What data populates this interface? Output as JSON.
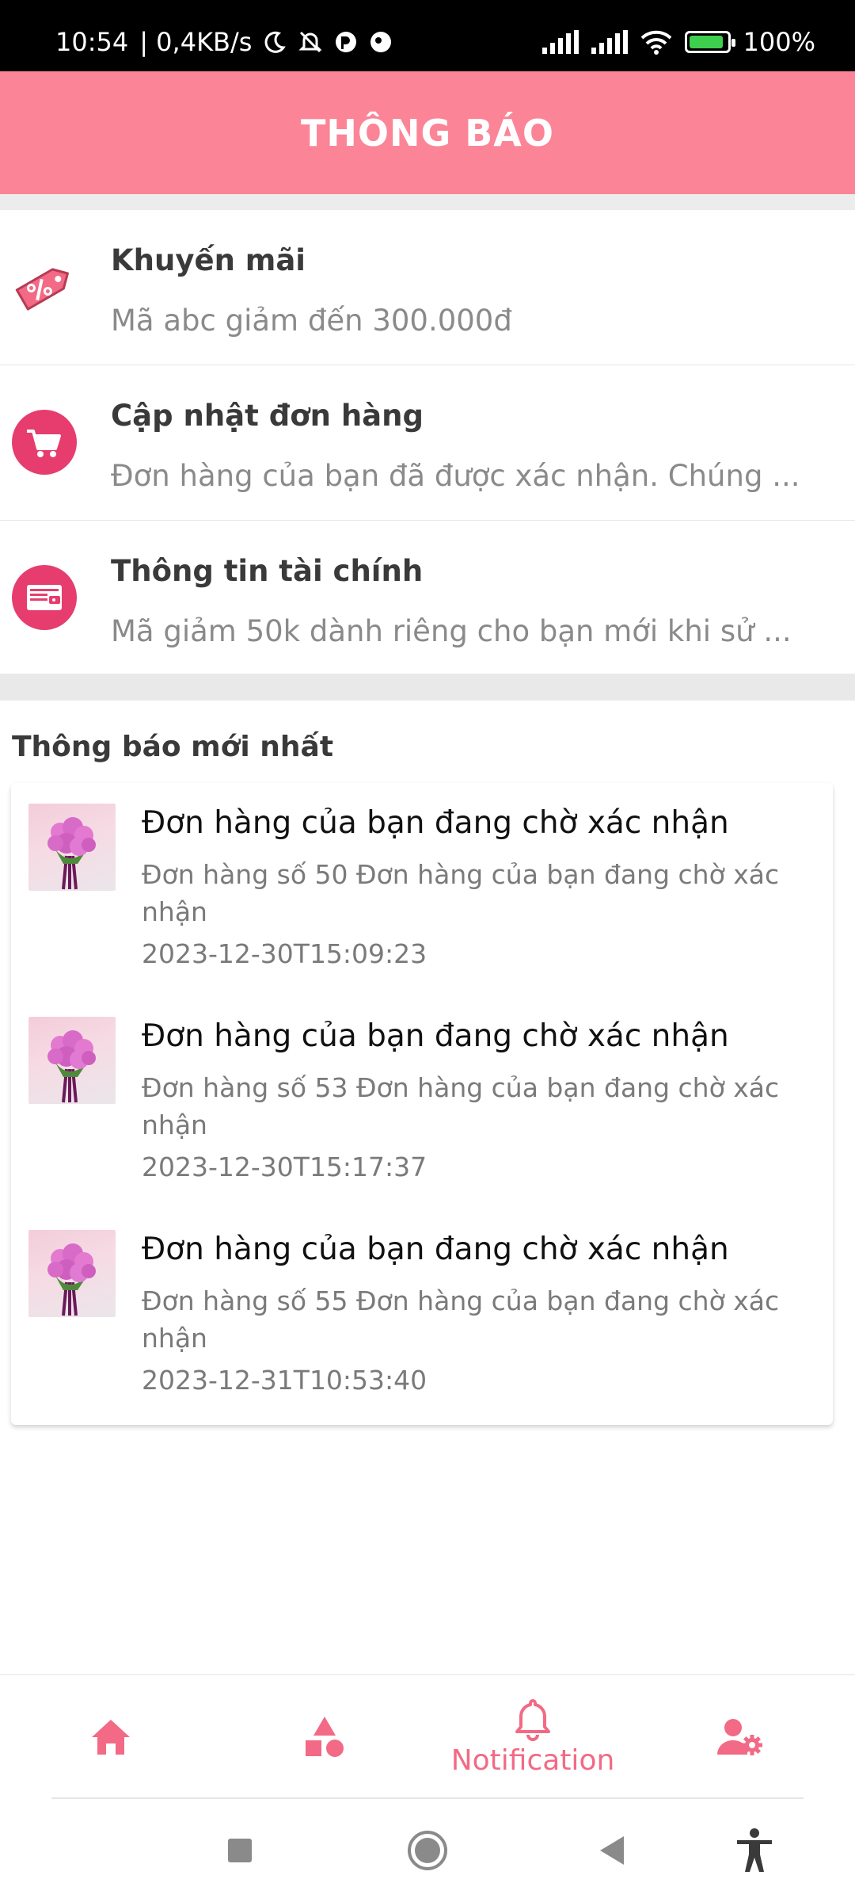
{
  "status_bar": {
    "time": "10:54",
    "speed": "| 0,4KB/s",
    "battery": "100%"
  },
  "header": {
    "title": "THÔNG BÁO"
  },
  "categories": [
    {
      "icon": "discount-tag-icon",
      "title": "Khuyến mãi",
      "desc": "Mã abc giảm đến 300.000đ"
    },
    {
      "icon": "cart-icon",
      "title": "Cập nhật đơn hàng",
      "desc": "Đơn hàng của bạn đã được xác nhận. Chúng ..."
    },
    {
      "icon": "wallet-icon",
      "title": "Thông tin tài chính",
      "desc": "Mã giảm 50k dành riêng cho bạn mới khi sử ..."
    }
  ],
  "latest": {
    "heading": "Thông báo mới nhất",
    "items": [
      {
        "title": "Đơn hàng của bạn đang chờ xác nhận",
        "body": "Đơn hàng số 50 Đơn hàng của bạn đang chờ xác nhận",
        "time": "2023-12-30T15:09:23"
      },
      {
        "title": "Đơn hàng của bạn đang chờ xác nhận",
        "body": "Đơn hàng số 53 Đơn hàng của bạn đang chờ xác nhận",
        "time": "2023-12-30T15:17:37"
      },
      {
        "title": "Đơn hàng của bạn đang chờ xác nhận",
        "body": "Đơn hàng số 55 Đơn hàng của bạn đang chờ xác nhận",
        "time": "2023-12-31T10:53:40"
      }
    ]
  },
  "bottom_nav": {
    "active": "notification",
    "items": [
      {
        "icon": "home-icon",
        "label": ""
      },
      {
        "icon": "shapes-icon",
        "label": ""
      },
      {
        "icon": "bell-icon",
        "label": "Notification"
      },
      {
        "icon": "user-settings-icon",
        "label": ""
      }
    ]
  },
  "colors": {
    "accent": "#fb8597",
    "icon_pink": "#f26a85",
    "icon_magenta": "#e63d6e"
  }
}
